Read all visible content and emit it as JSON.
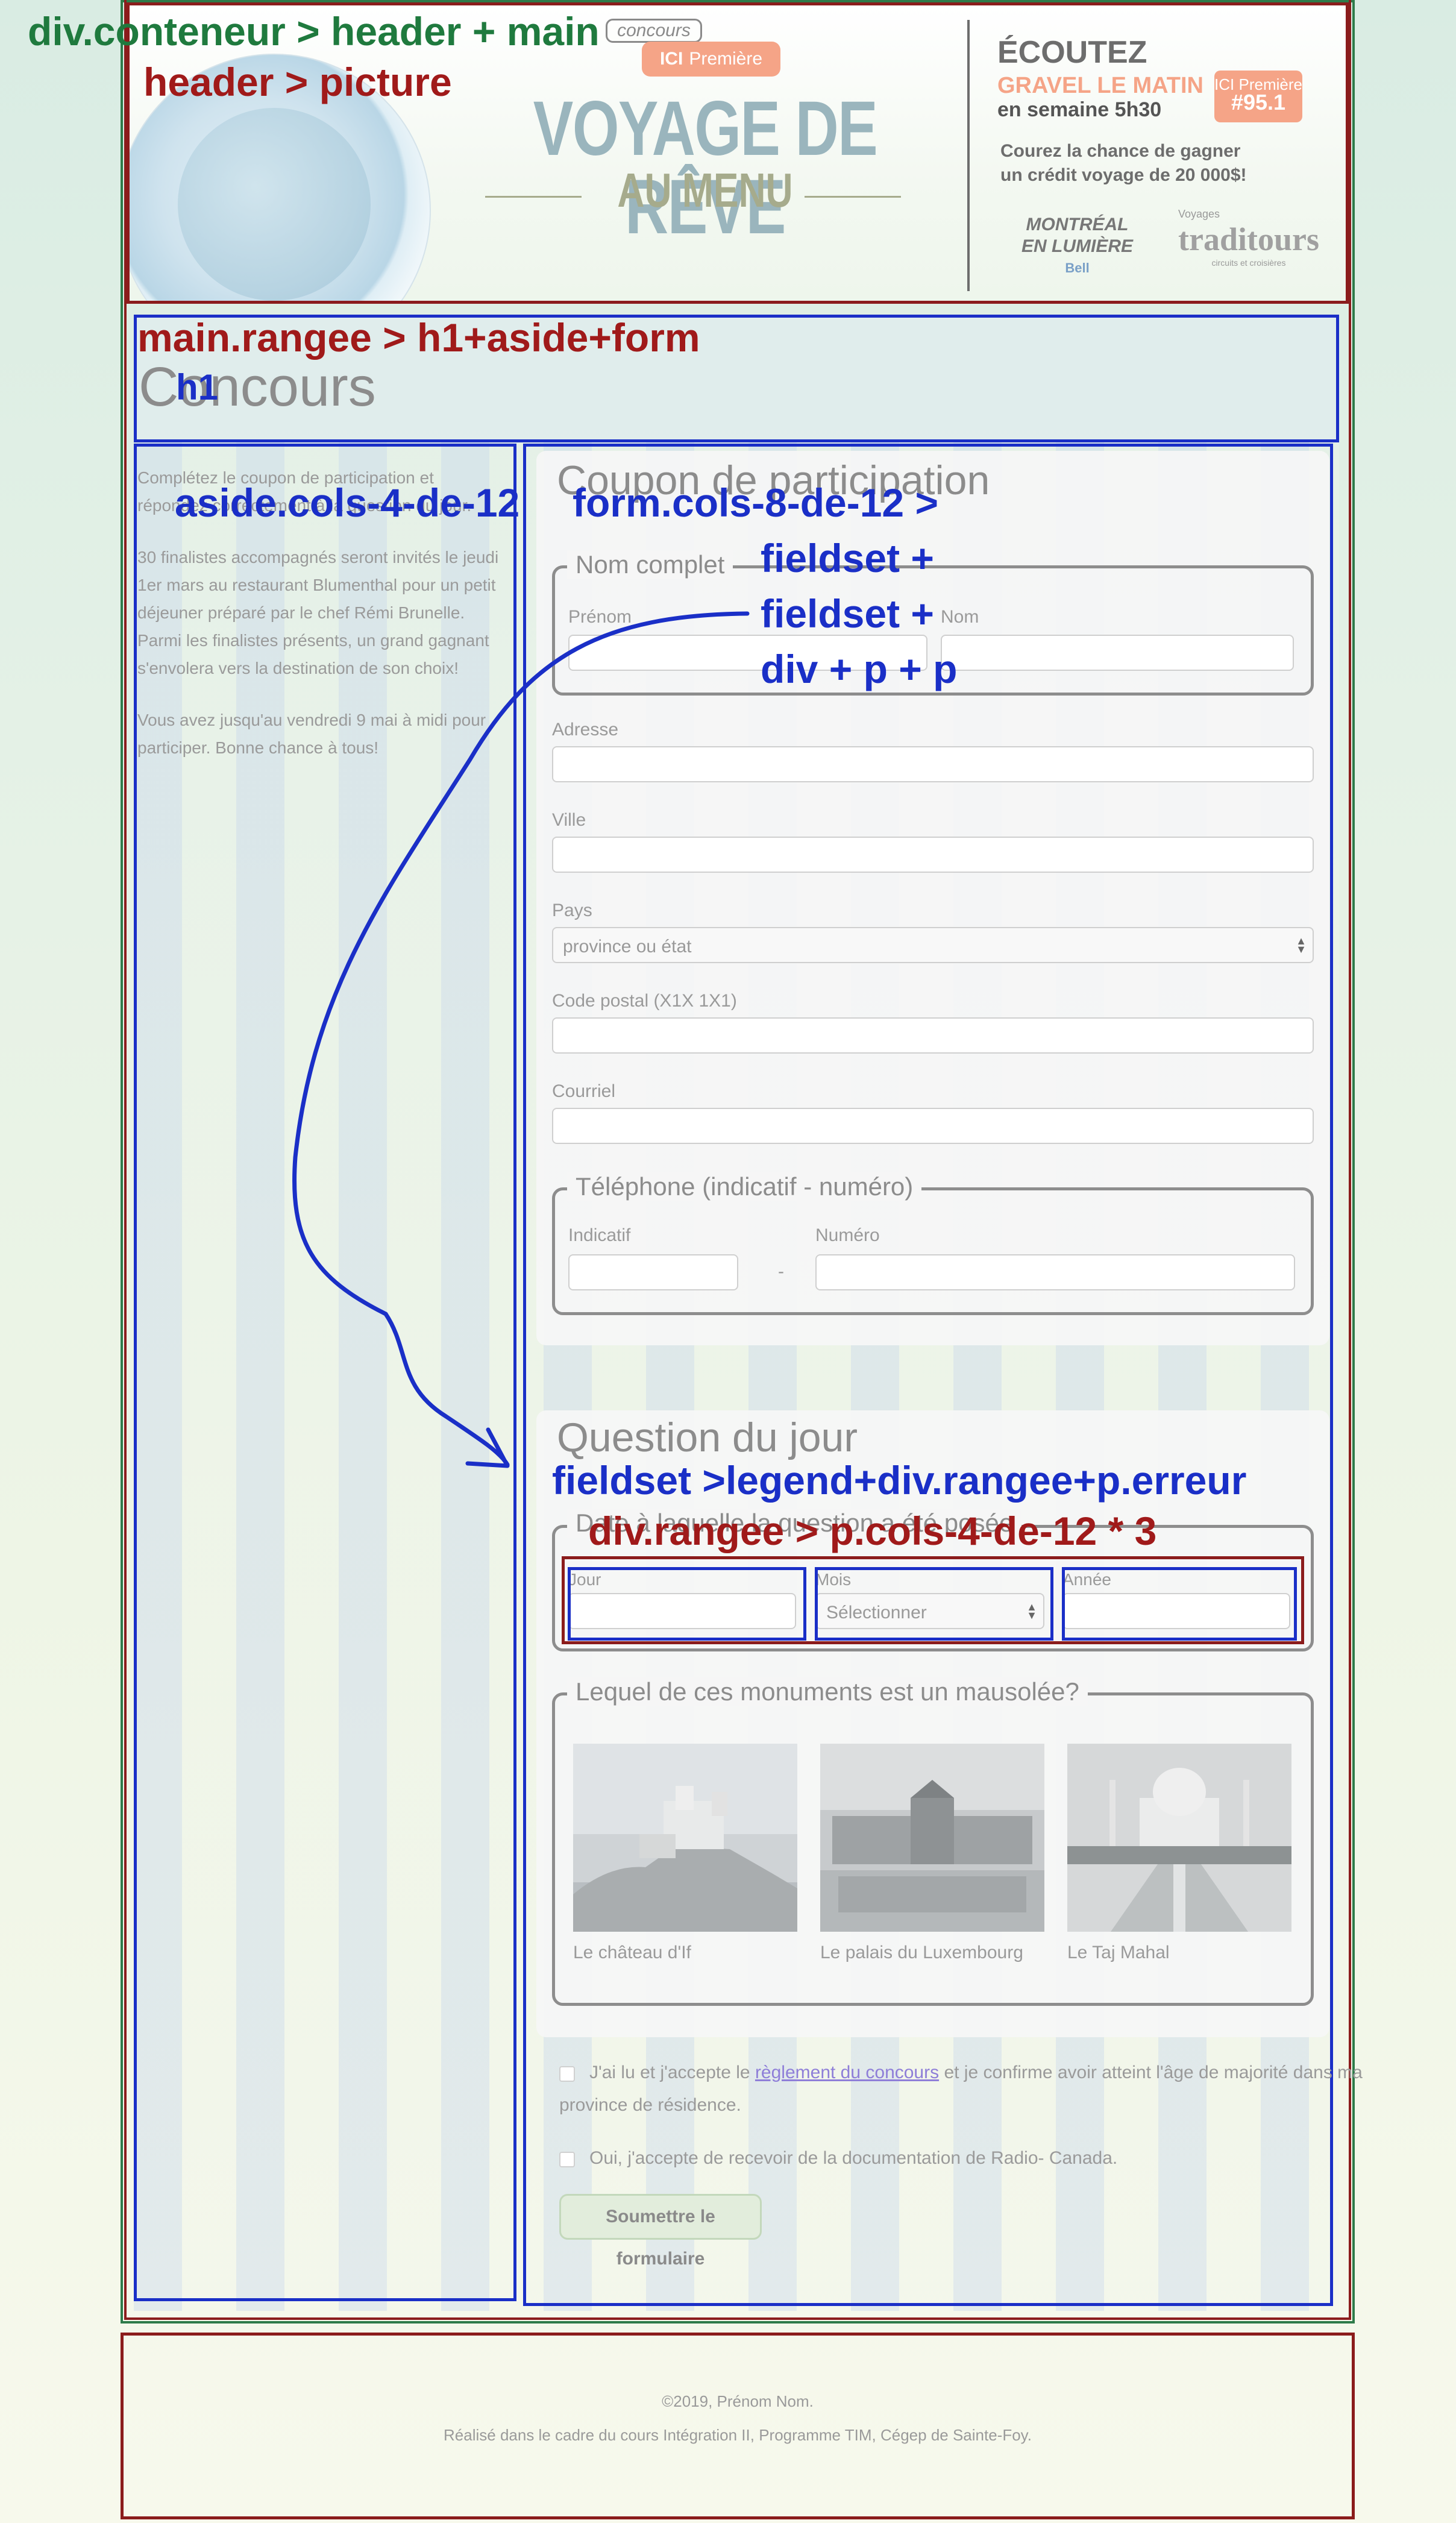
{
  "annotations": {
    "conteneur": "div.conteneur > header + main",
    "header": "header > picture",
    "main": "main.rangee > h1+aside+form",
    "h1": "h1",
    "aside": "aside.cols-4-de-12",
    "form_line1": "form.cols-8-de-12 >",
    "form_line2": "fieldset +",
    "form_line3": "fieldset +",
    "form_line4": "div + p + p",
    "question_fieldset": "fieldset >legend+div.rangee+p.erreur",
    "question_rangee": "div.rangee > p.cols-4-de-12 * 3"
  },
  "header": {
    "concours_badge": "concours",
    "ici_label": "ICI",
    "premiere_label": "Première",
    "title_line1": "VOYAGE DE RÊVE",
    "title_line2": "AU MENU",
    "ecoutez": "ÉCOUTEZ",
    "show": "GRAVEL LE MATIN",
    "schedule": "en semaine 5h30",
    "station_ici": "ICI Première",
    "station_freq": "#95.1",
    "prize_line1": "Courez la chance de gagner",
    "prize_line2": "un crédit voyage de 20 000$!",
    "sponsor1_line1": "MONTRÉAL",
    "sponsor1_line2": "EN LUMIÈRE",
    "sponsor1_bell": "Bell",
    "sponsor2_top": "Voyages",
    "sponsor2_name": "traditours",
    "sponsor2_sub": "circuits et croisières"
  },
  "main": {
    "h1": "Concours",
    "aside": {
      "p1": "Complétez le coupon de participation et répondez correctement à la question du jour.",
      "p2": "30 finalistes accompagnés seront invités le jeudi 1er mars au restaurant Blumenthal pour un petit déjeuner préparé par le chef Rémi Brunelle. Parmi les finalistes présents, un grand gagnant s'envolera vers la destination de son choix!",
      "p3": "Vous avez jusqu'au vendredi 9 mai à midi pour participer. Bonne chance à tous!"
    },
    "coupon": {
      "title": "Coupon de participation",
      "nom_complet_legend": "Nom complet",
      "prenom_label": "Prénom",
      "nom_label": "Nom",
      "adresse_label": "Adresse",
      "ville_label": "Ville",
      "pays_label": "Pays",
      "pays_value": "province ou état",
      "code_postal_label": "Code postal (X1X 1X1)",
      "courriel_label": "Courriel",
      "telephone_legend": "Téléphone (indicatif - numéro)",
      "indicatif_label": "Indicatif",
      "numero_label": "Numéro",
      "separator": "-"
    },
    "question": {
      "title": "Question du jour",
      "date_legend": "Date à laquelle la question a été posée",
      "jour_label": "Jour",
      "mois_label": "Mois",
      "mois_value": "Sélectionner",
      "annee_label": "Année",
      "monument_legend": "Lequel de ces monuments est un mausolée?",
      "options": [
        {
          "label": "Le château d'If"
        },
        {
          "label": "Le palais du Luxembourg"
        },
        {
          "label": "Le Taj Mahal"
        }
      ]
    },
    "consent": {
      "line1_before": "J'ai lu et j'accepte le ",
      "line1_link": "règlement du concours",
      "line1_after": " et je confirme avoir atteint l'âge de majorité dans ma",
      "line1_cont": "province de résidence.",
      "line2": "Oui, j'accepte de recevoir de la documentation de Radio- Canada.",
      "submit": "Soumettre le formulaire"
    }
  },
  "footer": {
    "copyright": "©2019, Prénom Nom.",
    "credit": "Réalisé dans le cadre du cours Intégration II, Programme TIM, Cégep de Sainte-Foy."
  }
}
